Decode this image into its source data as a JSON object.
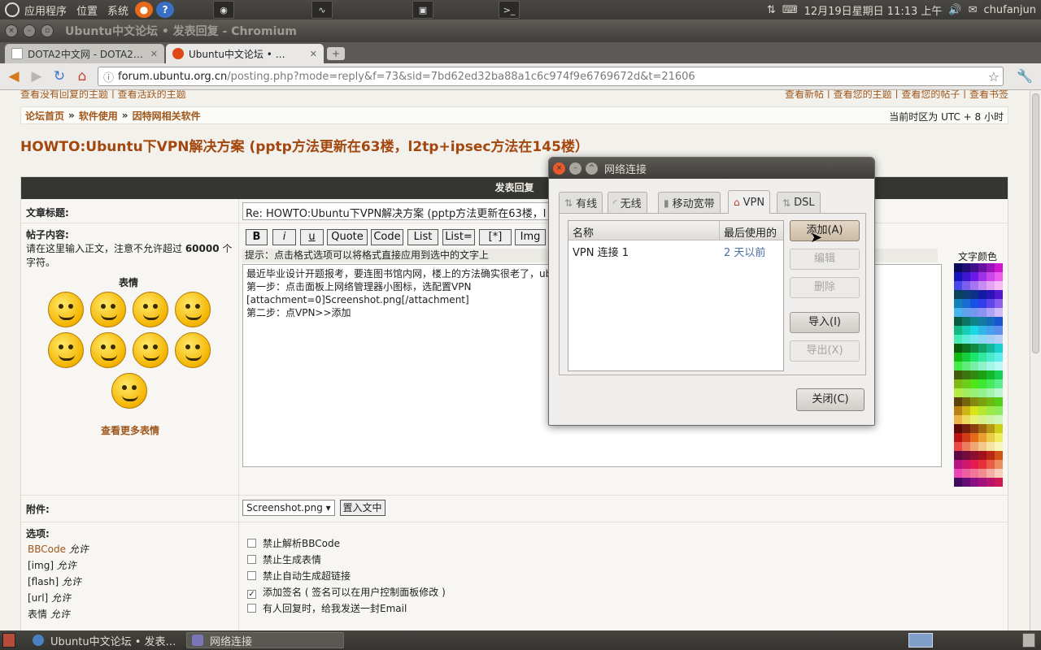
{
  "top_panel": {
    "menus": [
      "应用程序",
      "位置",
      "系统"
    ],
    "datetime": "12月19日星期日 11:13 上午",
    "user": "chufanjun"
  },
  "window": {
    "title": "Ubuntu中文论坛 • 发表回复 - Chromium"
  },
  "tabs": [
    {
      "label": "DOTA2中文网 - DOTA2…",
      "active": false
    },
    {
      "label": "Ubuntu中文论坛 • …",
      "active": true
    }
  ],
  "address_bar": {
    "host": "forum.ubuntu.org.cn",
    "path": "/posting.php?mode=reply&f=73&sid=7bd62ed32ba88a1c6c974f9e6769672d&t=21606"
  },
  "page": {
    "top_links_left": "查看没有回复的主题 | 查看活跃的主题",
    "top_links_right": "查看新帖 | 查看您的主题 | 查看您的帖子 | 查看书签",
    "breadcrumb": [
      "论坛首页",
      "软件使用",
      "因特网相关软件"
    ],
    "breadcrumb_sep": "»",
    "timezone": "当前时区为 UTC + 8 小时",
    "topic_title": "HOWTO:Ubuntu下VPN解决方案 (pptp方法更新在63楼，l2tp+ipsec方法在145楼）",
    "panel_header": "发表回复",
    "subject_label": "文章标题:",
    "subject_value": "Re:  HOWTO:Ubuntu下VPN解决方案 (pptp方法更新在63楼，l",
    "content_label": "帖子内容:",
    "content_note_prefix": "请在这里输入正文，注意不允许超过 ",
    "content_note_limit": "60000",
    "content_note_suffix": " 个字符。",
    "bbcode_buttons": [
      "B",
      "i",
      "u",
      "Quote",
      "Code",
      "List",
      "List=",
      "[*]",
      "Img"
    ],
    "hint": "提示：点击格式选项可以将格式直接应用到选中的文字上",
    "textarea_lines": [
      "最近毕业设计开题报考，要连图书馆内网，楼上的方法确实很老了，ub",
      "第一步：点击面板上网络管理器小图标，选配置VPN",
      "[attachment=0]Screenshot.png[/attachment]",
      "第二步：点VPN>>添加"
    ],
    "emoticons_title": "表情",
    "more_emoticons": "查看更多表情",
    "text_color_label": "文字颜色",
    "attachment_label": "附件:",
    "attachment_file": "Screenshot.png",
    "insert_button": "置入文中",
    "options_label": "选项:",
    "options_left": [
      {
        "name": "BBCode",
        "status": "允许"
      },
      {
        "name": "[img]",
        "status": "允许"
      },
      {
        "name": "[flash]",
        "status": "允许"
      },
      {
        "name": "[url]",
        "status": "允许"
      },
      {
        "name": "表情",
        "status": "允许"
      }
    ],
    "checkboxes": [
      {
        "label": "禁止解析BBCode",
        "checked": false
      },
      {
        "label": "禁止生成表情",
        "checked": false
      },
      {
        "label": "禁止自动生成超链接",
        "checked": false
      },
      {
        "label": "添加签名 ( 签名可以在用户控制面板修改 )",
        "checked": true
      },
      {
        "label": "有人回复时，给我发送一封Email",
        "checked": false
      }
    ]
  },
  "dialog": {
    "title": "网络连接",
    "tabs": [
      "有线",
      "无线",
      "移动宽带",
      "VPN",
      "DSL"
    ],
    "active_tab": "VPN",
    "columns": [
      "名称",
      "最后使用的"
    ],
    "rows": [
      {
        "name": "VPN 连接 1",
        "last_used": "2 天以前"
      }
    ],
    "buttons": {
      "add": "添加(A)",
      "edit": "编辑",
      "delete": "删除",
      "import": "导入(I)",
      "export": "导出(X)",
      "close": "关闭(C)"
    }
  },
  "taskbar": {
    "items": [
      "Ubuntu中文论坛 • 发表…",
      "网络连接"
    ]
  },
  "colors": {
    "link": "#a0571c",
    "title": "#a3470e",
    "panel_header": "#353531"
  }
}
